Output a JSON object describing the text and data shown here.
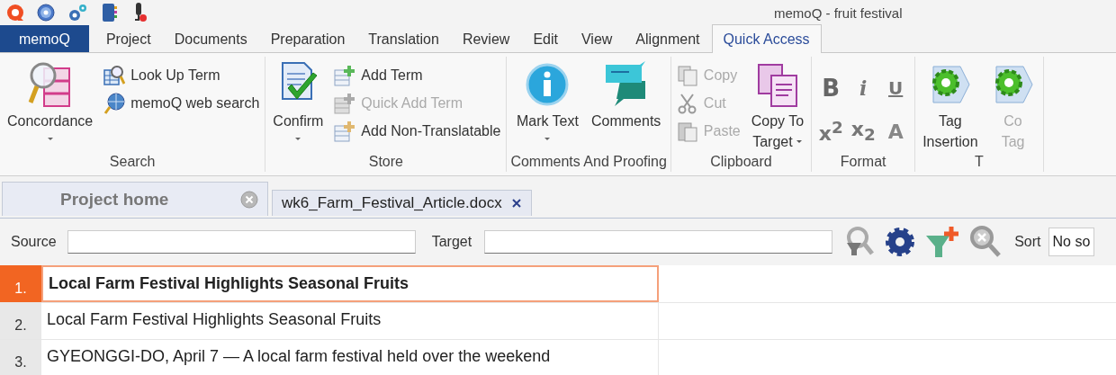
{
  "window": {
    "title": "memoQ - fruit festival"
  },
  "menu_tabs": [
    {
      "label": "memoQ",
      "kind": "app",
      "selected": false
    },
    {
      "label": "Project",
      "kind": "tab",
      "selected": false
    },
    {
      "label": "Documents",
      "kind": "tab",
      "selected": false
    },
    {
      "label": "Preparation",
      "kind": "tab",
      "selected": false
    },
    {
      "label": "Translation",
      "kind": "tab",
      "selected": false
    },
    {
      "label": "Review",
      "kind": "tab",
      "selected": false
    },
    {
      "label": "Edit",
      "kind": "tab",
      "selected": false
    },
    {
      "label": "View",
      "kind": "tab",
      "selected": false
    },
    {
      "label": "Alignment",
      "kind": "tab",
      "selected": false
    },
    {
      "label": "Quick Access",
      "kind": "tab",
      "selected": true
    }
  ],
  "ribbon_groups": [
    {
      "label": "Search",
      "items": [
        {
          "kind": "large",
          "lines": [
            "Concordance"
          ],
          "dropdown": true,
          "disabled": false
        },
        {
          "kind": "small",
          "label": "Look Up Term",
          "disabled": false
        },
        {
          "kind": "small",
          "label": "memoQ web search",
          "disabled": false
        }
      ]
    },
    {
      "label": "Store",
      "items": [
        {
          "kind": "large",
          "lines": [
            "Confirm"
          ],
          "dropdown": true,
          "disabled": false
        },
        {
          "kind": "small",
          "label": "Add Term",
          "disabled": false
        },
        {
          "kind": "small",
          "label": "Quick Add Term",
          "disabled": true
        },
        {
          "kind": "small",
          "label": "Add Non-Translatable",
          "disabled": false
        }
      ]
    },
    {
      "label": "Comments And Proofing",
      "items": [
        {
          "kind": "large",
          "lines": [
            "Mark Text"
          ],
          "dropdown": true,
          "disabled": false
        },
        {
          "kind": "large",
          "lines": [
            "Comments"
          ],
          "dropdown": false,
          "disabled": false
        }
      ]
    },
    {
      "label": "Clipboard",
      "items": [
        {
          "kind": "small",
          "label": "Copy",
          "disabled": true
        },
        {
          "kind": "small",
          "label": "Cut",
          "disabled": true
        },
        {
          "kind": "small",
          "label": "Paste",
          "disabled": true
        },
        {
          "kind": "large",
          "lines": [
            "Copy To",
            "Target"
          ],
          "dropdown": true,
          "disabled": false
        }
      ]
    },
    {
      "label": "Format",
      "items": [
        {
          "kind": "glyph",
          "glyph": "B"
        },
        {
          "kind": "glyph",
          "glyph": "i"
        },
        {
          "kind": "glyph",
          "glyph": "U"
        },
        {
          "kind": "glyph",
          "glyph": "x$^{2}$"
        },
        {
          "kind": "glyph",
          "glyph": "x$_{2}$"
        },
        {
          "kind": "glyph",
          "glyph": "A"
        }
      ]
    },
    {
      "label": "T",
      "items": [
        {
          "kind": "large",
          "lines": [
            "Tag",
            "Insertion"
          ],
          "dropdown": false,
          "disabled": false
        },
        {
          "kind": "large",
          "lines": [
            "Co",
            "Tag"
          ],
          "dropdown": false,
          "disabled": true
        }
      ]
    }
  ],
  "document_tabs": [
    {
      "label": "Project home",
      "selected": false
    },
    {
      "label": "wk6_Farm_Festival_Article.docx",
      "selected": true
    }
  ],
  "filter_bar": {
    "source_label": "Source",
    "target_label": "Target",
    "sort_label": "Sort",
    "sort_value": "No so"
  },
  "segments": [
    {
      "number": "1.",
      "source": "Local Farm Festival Highlights Seasonal Fruits",
      "selected": true
    },
    {
      "number": "2.",
      "source": "Local Farm Festival Highlights Seasonal Fruits",
      "selected": false
    },
    {
      "number": "3.",
      "source": "GYEONGGI-DO, April 7 — A local farm festival held over the weekend",
      "selected": false
    }
  ]
}
